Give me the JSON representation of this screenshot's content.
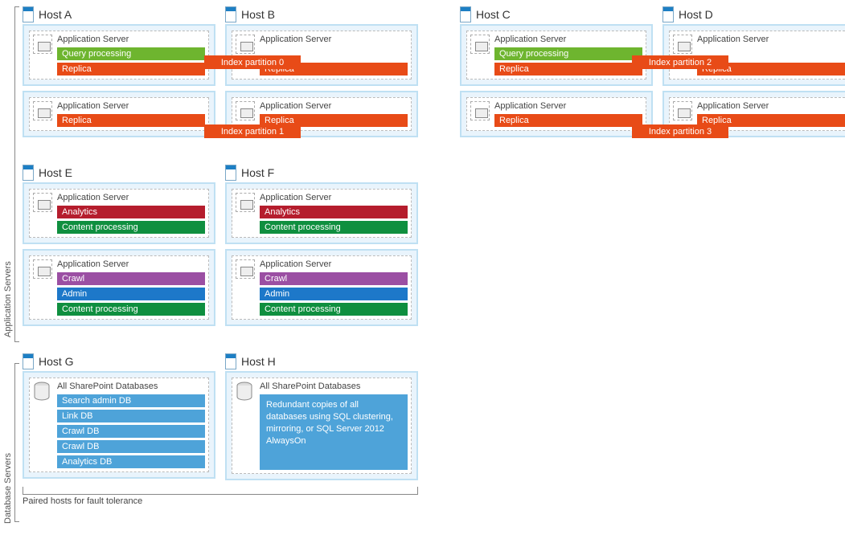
{
  "labels": {
    "section_app": "Application Servers",
    "section_db": "Database Servers",
    "paired": "Paired hosts for fault tolerance",
    "as": "Application Server",
    "alldb": "All SharePoint Databases"
  },
  "hosts": {
    "A": "Host A",
    "B": "Host B",
    "C": "Host C",
    "D": "Host D",
    "E": "Host E",
    "F": "Host F",
    "G": "Host G",
    "H": "Host H"
  },
  "roles": {
    "query": "Query processing",
    "replica": "Replica",
    "analytics": "Analytics",
    "content": "Content processing",
    "crawl": "Crawl",
    "admin": "Admin"
  },
  "partitions": {
    "p0": "Index partition 0",
    "p1": "Index partition 1",
    "p2": "Index partition 2",
    "p3": "Index partition 3"
  },
  "dbs": {
    "search": "Search admin DB",
    "link": "Link DB",
    "crawl1": "Crawl DB",
    "crawl2": "Crawl DB",
    "analytics": "Analytics DB"
  },
  "db_redundant": "Redundant copies of all databases using SQL clustering, mirroring, or SQL Server 2012 AlwaysOn"
}
